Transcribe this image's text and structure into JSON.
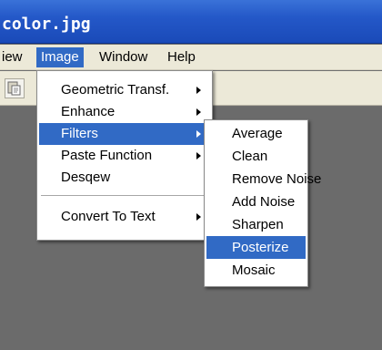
{
  "window": {
    "title": "color.jpg"
  },
  "menubar": {
    "items": [
      {
        "label": "iew"
      },
      {
        "label": "Image"
      },
      {
        "label": "Window"
      },
      {
        "label": "Help"
      }
    ]
  },
  "toolbar": {
    "icon": "paste-icon"
  },
  "image_menu": {
    "items": [
      {
        "label": "Geometric Transf."
      },
      {
        "label": "Enhance"
      },
      {
        "label": "Filters"
      },
      {
        "label": "Paste Function"
      },
      {
        "label": "Desqew"
      },
      {
        "label": "Convert To Text"
      }
    ]
  },
  "filters_menu": {
    "items": [
      {
        "label": "Average"
      },
      {
        "label": "Clean"
      },
      {
        "label": "Remove Noise"
      },
      {
        "label": "Add Noise"
      },
      {
        "label": "Sharpen"
      },
      {
        "label": "Posterize"
      },
      {
        "label": "Mosaic"
      }
    ]
  },
  "colors": {
    "highlight": "#316ac5",
    "titlebar": "#2458c8",
    "menubar": "#ece9d8",
    "workspace": "#6b6b6b"
  }
}
